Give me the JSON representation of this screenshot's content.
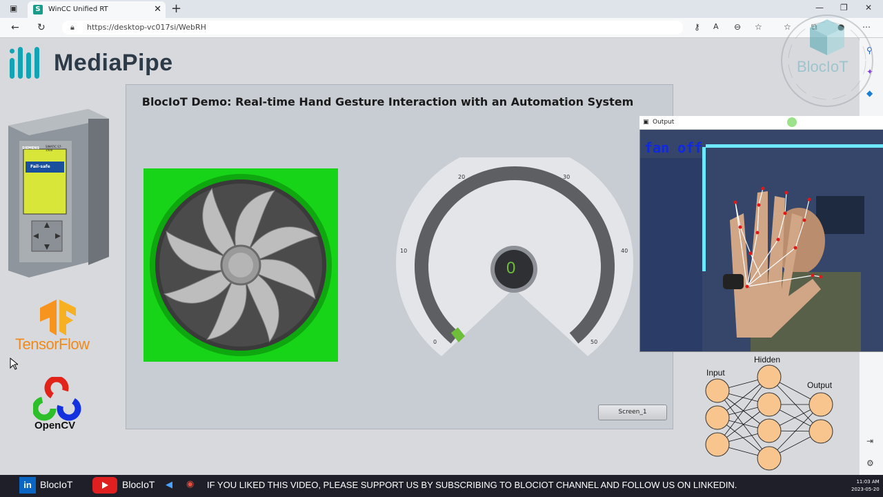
{
  "browser": {
    "tab_title": "WinCC Unified RT",
    "tab_favicon": "S",
    "url": "https://desktop-vc017si/WebRH"
  },
  "logos": {
    "mediapipe": "MediaPipe",
    "tensorflow": "TensorFlow",
    "opencv": "OpenCV",
    "watermark": "BlocIoT"
  },
  "plc": {
    "brand": "SIEMENS",
    "model": "SIMATIC S7-1500",
    "screen_title": "Fail-safe"
  },
  "panel": {
    "title": "BlocIoT Demo: Real-time Hand Gesture Interaction with an Automation System",
    "screen_button": "Screen_1"
  },
  "gauge": {
    "value": "0",
    "value_number": 0,
    "min": 0,
    "max": 50,
    "ticks": [
      "0",
      "10",
      "20",
      "30",
      "40",
      "50"
    ],
    "value_color": "#6fbe3a"
  },
  "output_window": {
    "title": "Output",
    "overlay_text": "fan  off",
    "overlay_color": "#1028e0"
  },
  "neural_net": {
    "input_label": "Input",
    "hidden_label": "Hidden",
    "output_label": "Output",
    "input_nodes": 3,
    "hidden_nodes": 4,
    "output_nodes": 2,
    "node_color": "#f9c58f"
  },
  "taskbar": {
    "apps": [
      "BlocIoT",
      "BlocIoT"
    ],
    "ticker": "IF YOU LIKED THIS VIDEO, PLEASE SUPPORT US BY SUBSCRIBING TO BLOCIOT CHANNEL AND FOLLOW US ON LINKEDIN.",
    "time": "11:03 AM",
    "date": "2023-05-20"
  },
  "colors": {
    "fan_background": "#18d418",
    "accent_teal": "#1a9c8a"
  }
}
